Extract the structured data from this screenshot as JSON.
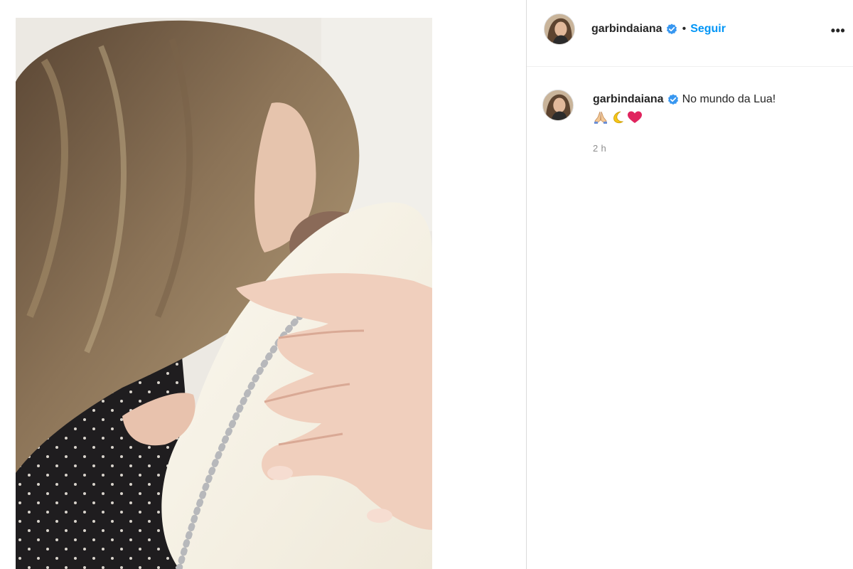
{
  "post": {
    "author": {
      "username": "garbindaiana",
      "verified_icon": "verified-badge-icon"
    },
    "separator": "•",
    "follow_label": "Seguir",
    "more_icon_text": "•••",
    "caption": {
      "username": "garbindaiana",
      "text": "No mundo da Lua!",
      "emoji_icons": [
        "folded-hands-icon",
        "crescent-moon-icon",
        "red-heart-icon"
      ]
    },
    "timestamp": "2 h"
  },
  "colors": {
    "accent": "#0095f6",
    "verified": "#3897f0",
    "text": "#262626",
    "muted": "#8e8e8e",
    "border": "#dbdbdb"
  }
}
